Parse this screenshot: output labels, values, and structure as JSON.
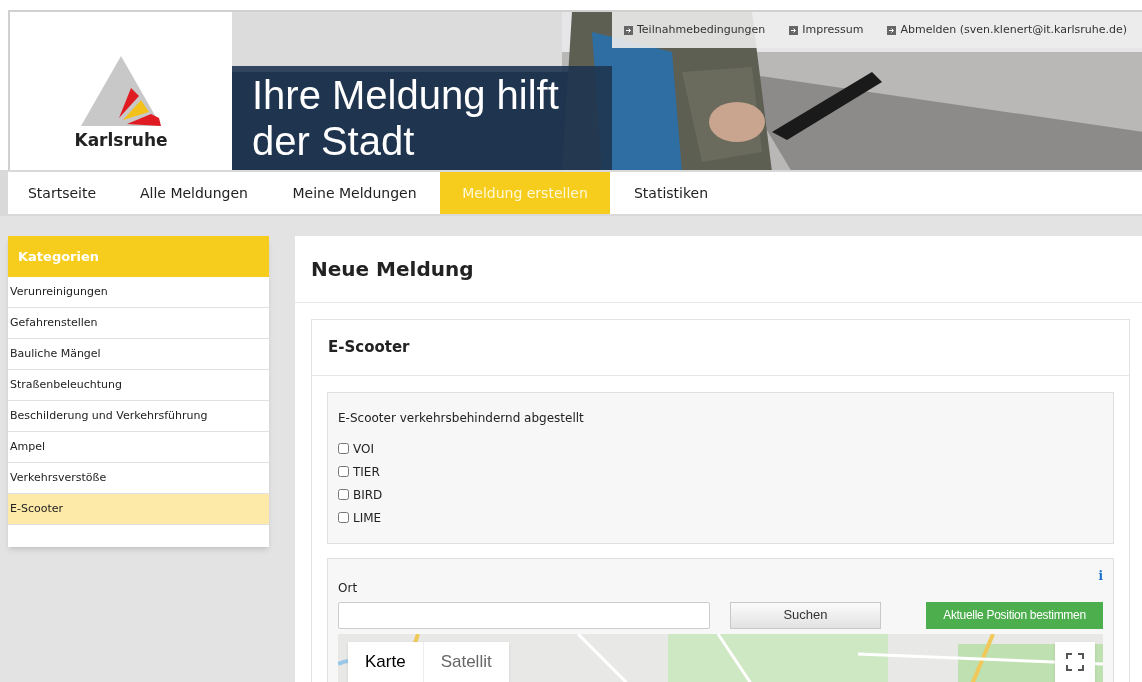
{
  "header": {
    "logo_text": "Karlsruhe",
    "headline_lines": [
      "Ihre Meldung hilft",
      "der Stadt"
    ],
    "links": [
      "Teilnahmebedingungen",
      "Impressum",
      "Abmelden (sven.klenert@it.karlsruhe.de)"
    ],
    "photo": {
      "kind": "picture"
    }
  },
  "nav": [
    {
      "label": "Startseite",
      "selected": false
    },
    {
      "label": "Alle Meldungen",
      "selected": false
    },
    {
      "label": "Meine Meldungen",
      "selected": false
    },
    {
      "label": "Meldung erstellen",
      "selected": true
    },
    {
      "label": "Statistiken",
      "selected": false
    }
  ],
  "sidebar": {
    "title": "Kategorien",
    "items": [
      {
        "label": "Verunreinigungen",
        "selected": false
      },
      {
        "label": "Gefahrenstellen",
        "selected": false
      },
      {
        "label": "Bauliche Mängel",
        "selected": false
      },
      {
        "label": "Straßenbeleuchtung",
        "selected": false
      },
      {
        "label": "Beschilderung und Verkehrsführung",
        "selected": false
      },
      {
        "label": "Ampel",
        "selected": false
      },
      {
        "label": "Verkehrsverstöße",
        "selected": false
      },
      {
        "label": "E-Scooter",
        "selected": true
      }
    ]
  },
  "main": {
    "title": "Neue Meldung",
    "card_title": "E-Scooter",
    "question": "E-Scooter verkehrsbehindernd abgestellt",
    "options": [
      {
        "label": "VOI",
        "checked": false
      },
      {
        "label": "TIER",
        "checked": false
      },
      {
        "label": "BIRD",
        "checked": false
      },
      {
        "label": "LIME",
        "checked": false
      }
    ],
    "location": {
      "label": "Ort",
      "info": "i",
      "search_button": "Suchen",
      "locate_button": "Aktuelle Position bestimmen",
      "map_types": [
        {
          "label": "Karte",
          "selected": true
        },
        {
          "label": "Satellit",
          "selected": false
        }
      ],
      "map": {
        "kind": "picture"
      }
    }
  }
}
